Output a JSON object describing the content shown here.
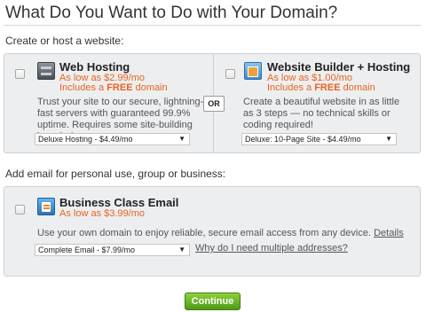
{
  "page": {
    "title": "What Do You Want to Do with Your Domain?"
  },
  "website_section": {
    "label": "Create or host a website:",
    "or_label": "OR",
    "web_hosting": {
      "name": "Web Hosting",
      "price": "As low as $2.99/mo",
      "promo_prefix": "Includes a ",
      "promo_free": "FREE",
      "promo_suffix": " domain",
      "description": "Trust your site to our secure, lightning-fast servers with guaranteed 99.9% uptime. Requires some site-building knowledge.",
      "select_value": "Deluxe Hosting - $4.49/mo",
      "checked": false
    },
    "website_builder": {
      "name": "Website Builder + Hosting",
      "price": "As low as $1.00/mo",
      "promo_prefix": "Includes a ",
      "promo_free": "FREE",
      "promo_suffix": " domain",
      "description": "Create a beautiful website in as little as 3 steps — no technical skills or coding required!",
      "select_value": "Deluxe: 10-Page Site - $4.49/mo",
      "checked": false
    }
  },
  "email_section": {
    "label": "Add email for personal use, group or business:",
    "business_email": {
      "name": "Business Class Email",
      "price": "As low as $3.99/mo",
      "description": "Use your own domain to enjoy reliable, secure email access from any device.",
      "details_link": "Details",
      "select_value": "Complete Email - $7.99/mo",
      "help_link": "Why do I need multiple addresses?",
      "checked": false
    }
  },
  "actions": {
    "continue_label": "Continue"
  },
  "icons": {
    "caret": "▼",
    "web_hosting": "server-icon",
    "website_builder": "website-builder-icon",
    "email": "email-icon"
  },
  "colors": {
    "price": "#e8641e",
    "continue": "#5fae1f",
    "panel_bg": "#edeef0"
  }
}
